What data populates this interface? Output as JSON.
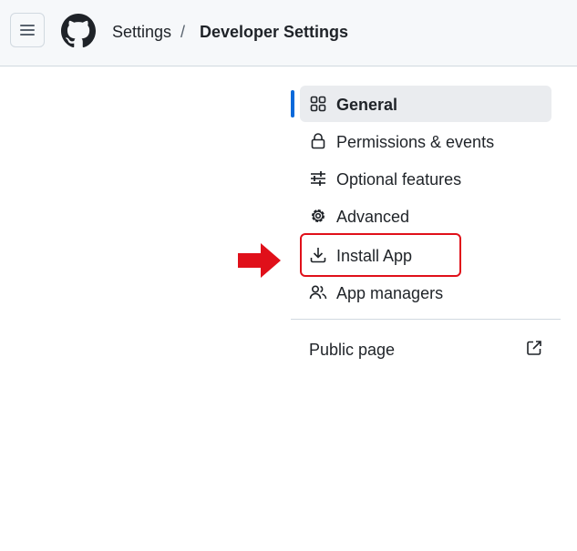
{
  "header": {
    "menu_icon": "hamburger-icon",
    "logo_icon": "github-mark-icon",
    "breadcrumb": {
      "parent": "Settings",
      "separator": "/",
      "current": "Developer Settings"
    }
  },
  "nav": {
    "items": [
      {
        "label": "General",
        "icon": "apps-grid-icon",
        "active": true
      },
      {
        "label": "Permissions & events",
        "icon": "lock-icon",
        "active": false
      },
      {
        "label": "Optional features",
        "icon": "sliders-icon",
        "active": false
      },
      {
        "label": "Advanced",
        "icon": "gear-icon",
        "active": false
      },
      {
        "label": "Install App",
        "icon": "download-icon",
        "active": false,
        "highlighted": true
      },
      {
        "label": "App managers",
        "icon": "people-icon",
        "active": false
      }
    ],
    "public_page": {
      "label": "Public page",
      "icon": "external-link-icon"
    }
  },
  "annotation": {
    "arrow_color": "#e0101a",
    "highlight_color": "#e0101a"
  },
  "colors": {
    "accent": "#0969da",
    "header_bg": "#f6f8fa",
    "active_bg": "#eaecef"
  }
}
